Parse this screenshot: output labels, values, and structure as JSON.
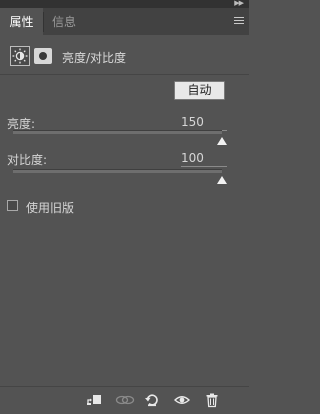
{
  "tabs": [
    {
      "label": "属性",
      "active": true
    },
    {
      "label": "信息",
      "active": false
    }
  ],
  "icons": {
    "collapse": "double-chevron-right-icon",
    "menu": "panel-menu-icon",
    "adjustment": "brightness-sun-icon",
    "mask": "layer-mask-icon",
    "clip": "clip-to-layer-icon",
    "view_previous": "view-previous-state-icon",
    "reset": "reset-icon",
    "visibility": "eye-icon",
    "delete": "trash-icon"
  },
  "adjustment": {
    "title": "亮度/对比度",
    "auto_label": "自动"
  },
  "brightness": {
    "label": "亮度:",
    "value": "150",
    "min": -150,
    "max": 150,
    "level": 150
  },
  "contrast": {
    "label": "对比度:",
    "value": "100",
    "min": -50,
    "max": 100,
    "level": 100
  },
  "legacy": {
    "label": "使用旧版",
    "checked": false
  },
  "colors": {
    "panel_bg": "#535353",
    "tabbar_bg": "#424242",
    "titlebar_bg": "#323232"
  }
}
